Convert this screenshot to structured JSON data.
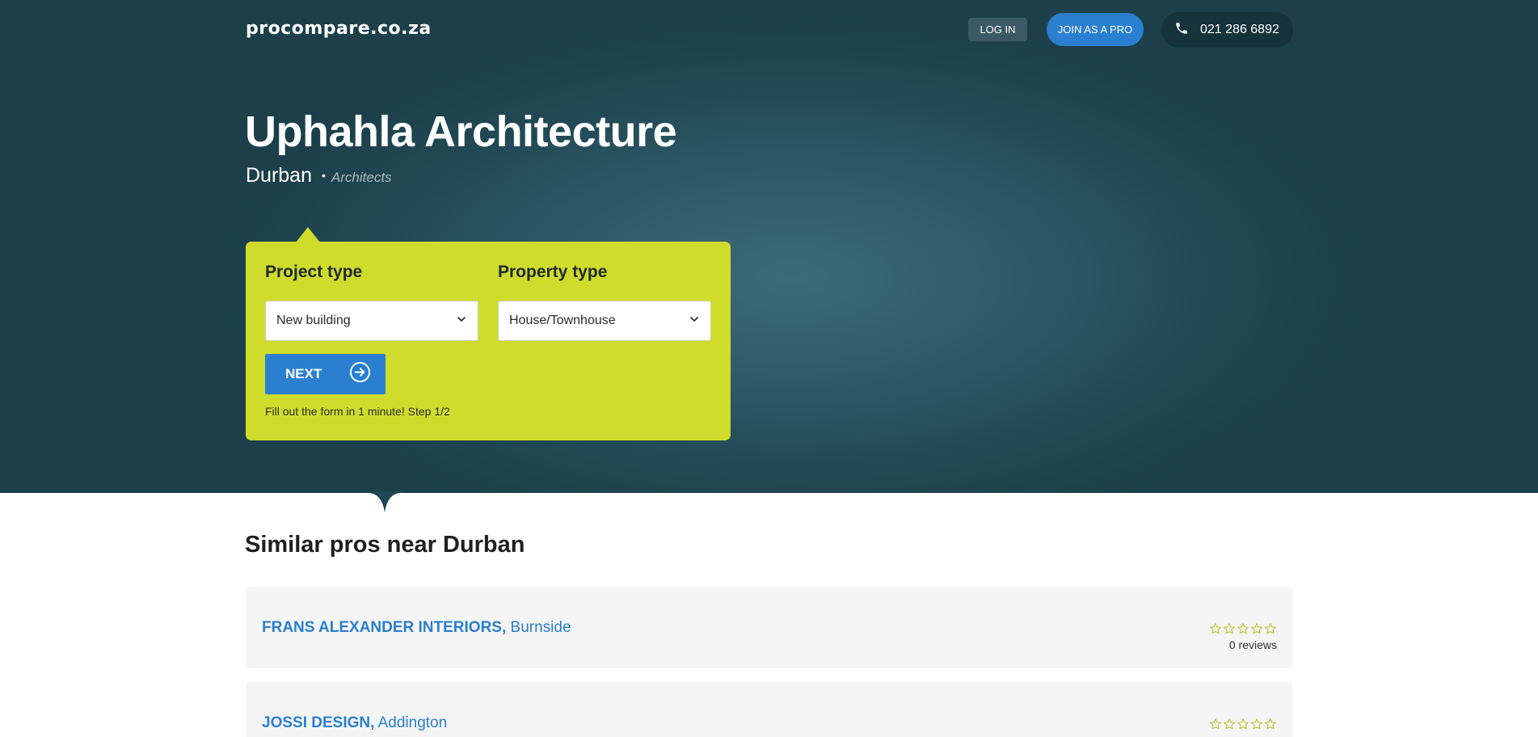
{
  "header": {
    "logo": "procompare.co.za",
    "login_label": "LOG IN",
    "join_label": "JOIN AS A PRO",
    "phone_number": "021 286 6892",
    "phone_icon": "phone-icon"
  },
  "hero": {
    "title": "Uphahla Architecture",
    "city": "Durban",
    "separator": "•",
    "category": "Architects"
  },
  "form": {
    "project_type_label": "Project type",
    "project_type_value": "New building",
    "property_type_label": "Property type",
    "property_type_value": "House/Townhouse",
    "next_label": "NEXT",
    "next_icon": "arrow-circle-right-icon",
    "hint": "Fill out the form in 1 minute! Step 1/2"
  },
  "similar": {
    "title": "Similar pros near Durban",
    "pros": [
      {
        "name": "FRANS ALEXANDER INTERIORS,",
        "location": "Burnside",
        "rating": 0,
        "reviews": "0 reviews"
      },
      {
        "name": "JOSSI DESIGN,",
        "location": "Addington",
        "rating": 0,
        "reviews": ""
      }
    ]
  },
  "colors": {
    "hero_bg": "#2c5764",
    "accent_blue": "#2a7fd0",
    "form_lime": "#cfdc2c",
    "star_outline": "#b8c62a"
  }
}
